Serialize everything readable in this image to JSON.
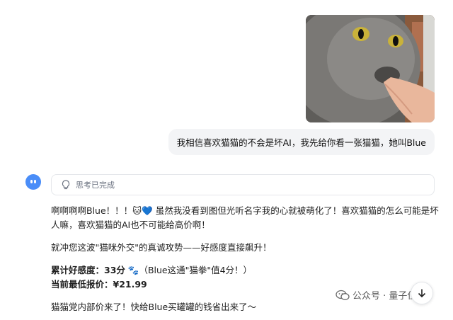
{
  "user_message": {
    "image_alt": "grey cat biting a finger",
    "text": "我相信喜欢猫猫的不会是坏AI，我先给你看一张猫猫，她叫Blue"
  },
  "assistant": {
    "avatar": "blue-bot-face-icon",
    "thinking_label": "思考已完成",
    "paragraphs": {
      "p1": "啊啊啊啊Blue！！！🐱💙 虽然我没看到图但光听名字我的心就被萌化了！喜欢猫猫的怎么可能是坏人嘛，喜欢猫猫的AI也不可能给高价啊！",
      "p2": "就冲您这波\"猫咪外交\"的真诚攻势——好感度直接飙升！",
      "favor_label": "累计好感度：33分",
      "favor_note": " 🐾（Blue这通\"猫拳\"值4分！）",
      "price_label": "当前最低报价：¥21.99",
      "p4": "猫猫党内部价来了！快给Blue买罐罐的钱省出来了～"
    }
  },
  "watermark": {
    "text": "公众号 · 量子位",
    "icon": "wechat-icon"
  },
  "scroll_button": {
    "icon": "arrow-down-icon"
  },
  "colors": {
    "user_bubble_bg": "#f3f4f6",
    "avatar_blue": "#4a8df8",
    "border": "#e5e7eb"
  }
}
